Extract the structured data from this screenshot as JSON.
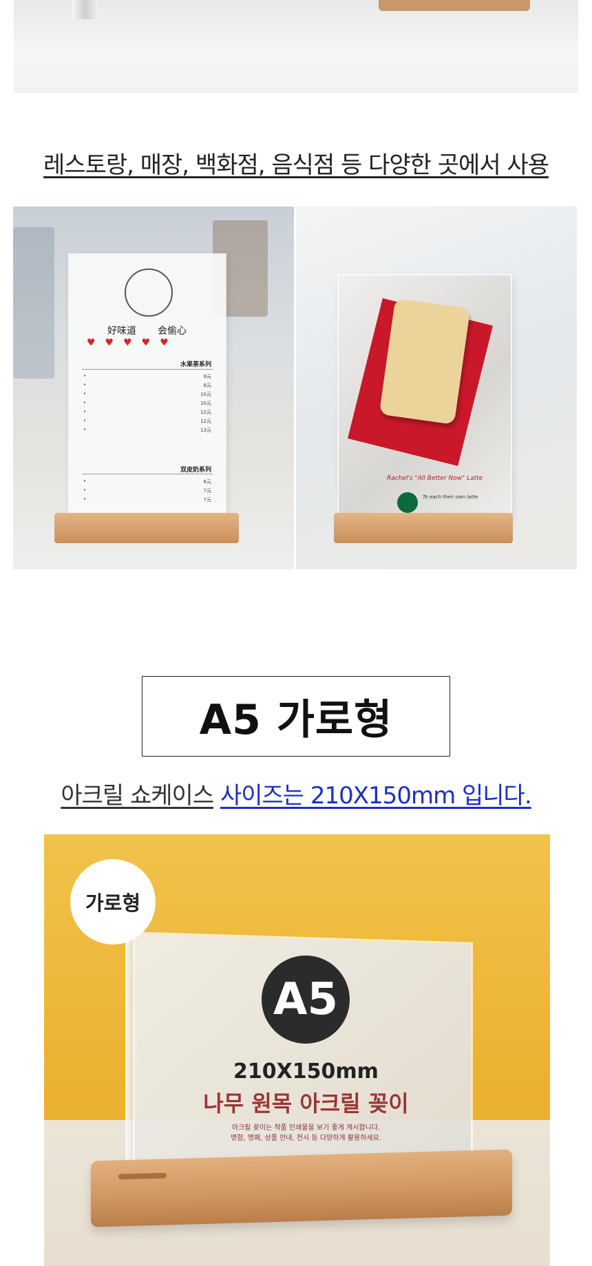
{
  "captions": {
    "places": "레스토랑, 매장, 백화점, 음식점 등 다양한 곳에서 사용",
    "size_prefix": "아크릴 쇼케이스",
    "size_value": "사이즈는 210X150mm 입니다."
  },
  "section_title": "A5 가로형",
  "left_photo": {
    "menu_titles": [
      "好味道",
      "会偷心"
    ],
    "hearts": "♥♥♥♥♥",
    "section1": "水果茶系列",
    "section1_prices": [
      "8元",
      "8元",
      "10元",
      "10元",
      "12元",
      "12元",
      "13元"
    ],
    "section2": "双皮奶系列",
    "section2_prices": [
      "6元",
      "7元",
      "7元"
    ]
  },
  "right_photo": {
    "caption": "Rachel's \"All Better Now\" Latte",
    "tagline": "To each their own latte"
  },
  "hero": {
    "badge": "가로형",
    "size_label": "A5",
    "dimensions": "210X150mm",
    "product_name": "나무 원목 아크릴 꽂이",
    "desc_line1": "아크릴 꽂이는 작품 인쇄물을 보기 좋게 게시합니다.",
    "desc_line2": "명함, 명패, 상품 안내, 전시 등 다양하게 활용하세요."
  },
  "colors": {
    "accent_blue": "#1a2ec8",
    "hero_yellow": "#ebb12f",
    "product_red": "#9a3535",
    "wood": "#c98f5c"
  }
}
